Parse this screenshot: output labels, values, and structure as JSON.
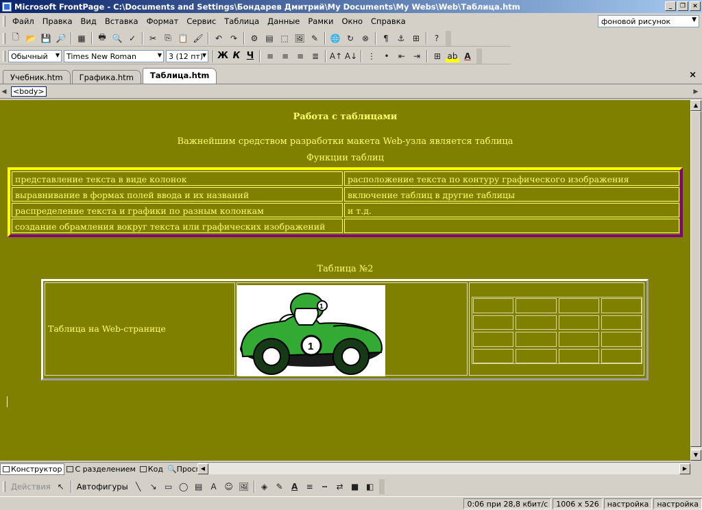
{
  "window": {
    "title": "Microsoft FrontPage - C:\\Documents and Settings\\Бондарев Дмитрий\\My Documents\\My Webs\\Web\\Таблица.htm",
    "min_label": "_",
    "max_label": "❐",
    "close_label": "×"
  },
  "menu": {
    "items": [
      "Файл",
      "Правка",
      "Вид",
      "Вставка",
      "Формат",
      "Сервис",
      "Таблица",
      "Данные",
      "Рамки",
      "Окно",
      "Справка"
    ],
    "help_box": "фоновой рисунок"
  },
  "format_toolbar": {
    "style": "Обычный",
    "font": "Times New Roman",
    "size": "3  (12 пт)",
    "bold": "Ж",
    "italic": "К",
    "underline": "Ч"
  },
  "tabs": [
    {
      "label": "Учебник.htm",
      "active": false
    },
    {
      "label": "Графика.htm",
      "active": false
    },
    {
      "label": "Таблица.htm",
      "active": true
    }
  ],
  "quick_tag": "<body>",
  "page": {
    "background": "#808000",
    "text_color": "#ffff66",
    "heading": "Работа с таблицами",
    "intro": "Важнейшим средством разработки макета Web-узла является таблица",
    "subheading": "Функции таблиц",
    "table1": [
      [
        "представление текста в виде колонок",
        "расположение текста по контуру графического изображения"
      ],
      [
        "выравнивание в формах полей ввода и их названий",
        "включение таблиц в другие таблицы"
      ],
      [
        "распределение текста и графики по разным колонкам",
        "и т.д."
      ],
      [
        "создание обрамления вокруг текста или графических изображений",
        ""
      ]
    ],
    "table2_caption": "Таблица №2",
    "table2_text": "Таблица на Web-странице",
    "table2_image": "race-car-clipart",
    "nested_grid": {
      "rows": 4,
      "cols": 4
    }
  },
  "view_tabs": [
    {
      "label": "Конструктор",
      "active": true
    },
    {
      "label": "С разделением",
      "active": false
    },
    {
      "label": "Код",
      "active": false
    },
    {
      "label": "Просмотр",
      "active": false
    }
  ],
  "drawing_toolbar": {
    "actions": "Действия",
    "autoshapes": "Автофигуры"
  },
  "status": {
    "download_time": "0:06 при 28,8 кбит/с",
    "page_size": "1006 x 526",
    "mode1": "настройка",
    "mode2": "настройка"
  }
}
